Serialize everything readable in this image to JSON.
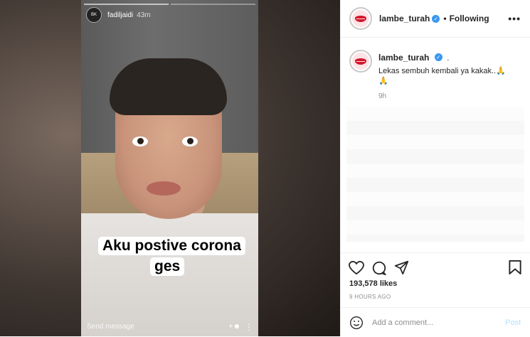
{
  "story": {
    "username": "fadiljaidi",
    "time": "43m",
    "caption_line1": "Aku postive corona",
    "caption_line2": "ges",
    "send_message": "Send message",
    "avatar_text": "BK"
  },
  "post": {
    "author": "lambe_turah",
    "follow_status": "Following",
    "separator": "•"
  },
  "comment": {
    "author": "lambe_turah",
    "text": "Lekas sembuh kembali ya kakak..🙏",
    "text_line2": "🙏",
    "time": "9h"
  },
  "engagement": {
    "likes": "193,578 likes",
    "time_ago": "9 HOURS AGO"
  },
  "add_comment": {
    "placeholder": "Add a comment...",
    "post_label": "Post"
  },
  "colors": {
    "verified": "#3897f0",
    "brand_lips": "#d0162a",
    "post_disabled": "#b2dffc"
  }
}
